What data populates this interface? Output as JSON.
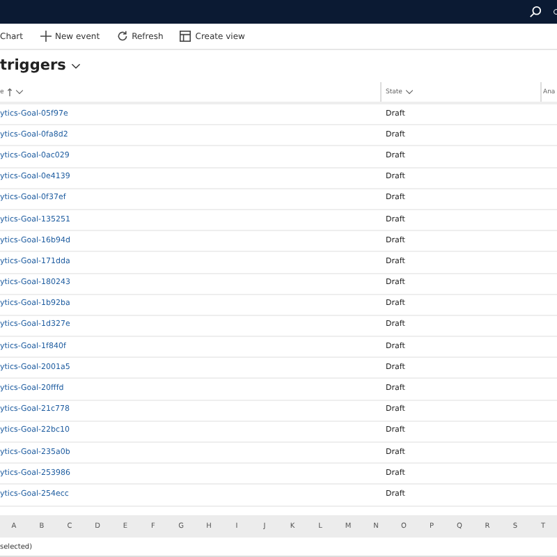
{
  "toolbar": [
    {
      "kind": "plain",
      "label": "Chart"
    },
    {
      "kind": "add",
      "label": "New event"
    },
    {
      "kind": "refresh",
      "label": "Refresh"
    },
    {
      "kind": "view",
      "label": "Create view"
    }
  ],
  "view_title": "triggers",
  "table": {
    "columns": [
      {
        "label": "e",
        "sorted": true
      },
      {
        "label": "State",
        "sorted": false
      },
      {
        "label": "Ana"
      }
    ],
    "rows": [
      {
        "name": "ytics-Goal-05f97e",
        "state": "Draft"
      },
      {
        "name": "ytics-Goal-0fa8d2",
        "state": "Draft"
      },
      {
        "name": "ytics-Goal-0ac029",
        "state": "Draft"
      },
      {
        "name": "ytics-Goal-0e4139",
        "state": "Draft"
      },
      {
        "name": "ytics-Goal-0f37ef",
        "state": "Draft"
      },
      {
        "name": "ytics-Goal-135251",
        "state": "Draft"
      },
      {
        "name": "ytics-Goal-16b94d",
        "state": "Draft"
      },
      {
        "name": "ytics-Goal-171dda",
        "state": "Draft"
      },
      {
        "name": "ytics-Goal-180243",
        "state": "Draft"
      },
      {
        "name": "ytics-Goal-1b92ba",
        "state": "Draft"
      },
      {
        "name": "ytics-Goal-1d327e",
        "state": "Draft"
      },
      {
        "name": "ytics-Goal-1f840f",
        "state": "Draft"
      },
      {
        "name": "ytics-Goal-2001a5",
        "state": "Draft"
      },
      {
        "name": "ytics-Goal-20fffd",
        "state": "Draft"
      },
      {
        "name": "ytics-Goal-21c778",
        "state": "Draft"
      },
      {
        "name": "ytics-Goal-22bc10",
        "state": "Draft"
      },
      {
        "name": "ytics-Goal-235a0b",
        "state": "Draft"
      },
      {
        "name": "ytics-Goal-253986",
        "state": "Draft"
      },
      {
        "name": "ytics-Goal-254ecc",
        "state": "Draft"
      }
    ]
  },
  "alphabet": [
    "A",
    "B",
    "C",
    "D",
    "E",
    "F",
    "G",
    "H",
    "I",
    "J",
    "K",
    "L",
    "M",
    "N",
    "O",
    "P",
    "Q",
    "R",
    "S",
    "T"
  ],
  "footer": "selected)"
}
